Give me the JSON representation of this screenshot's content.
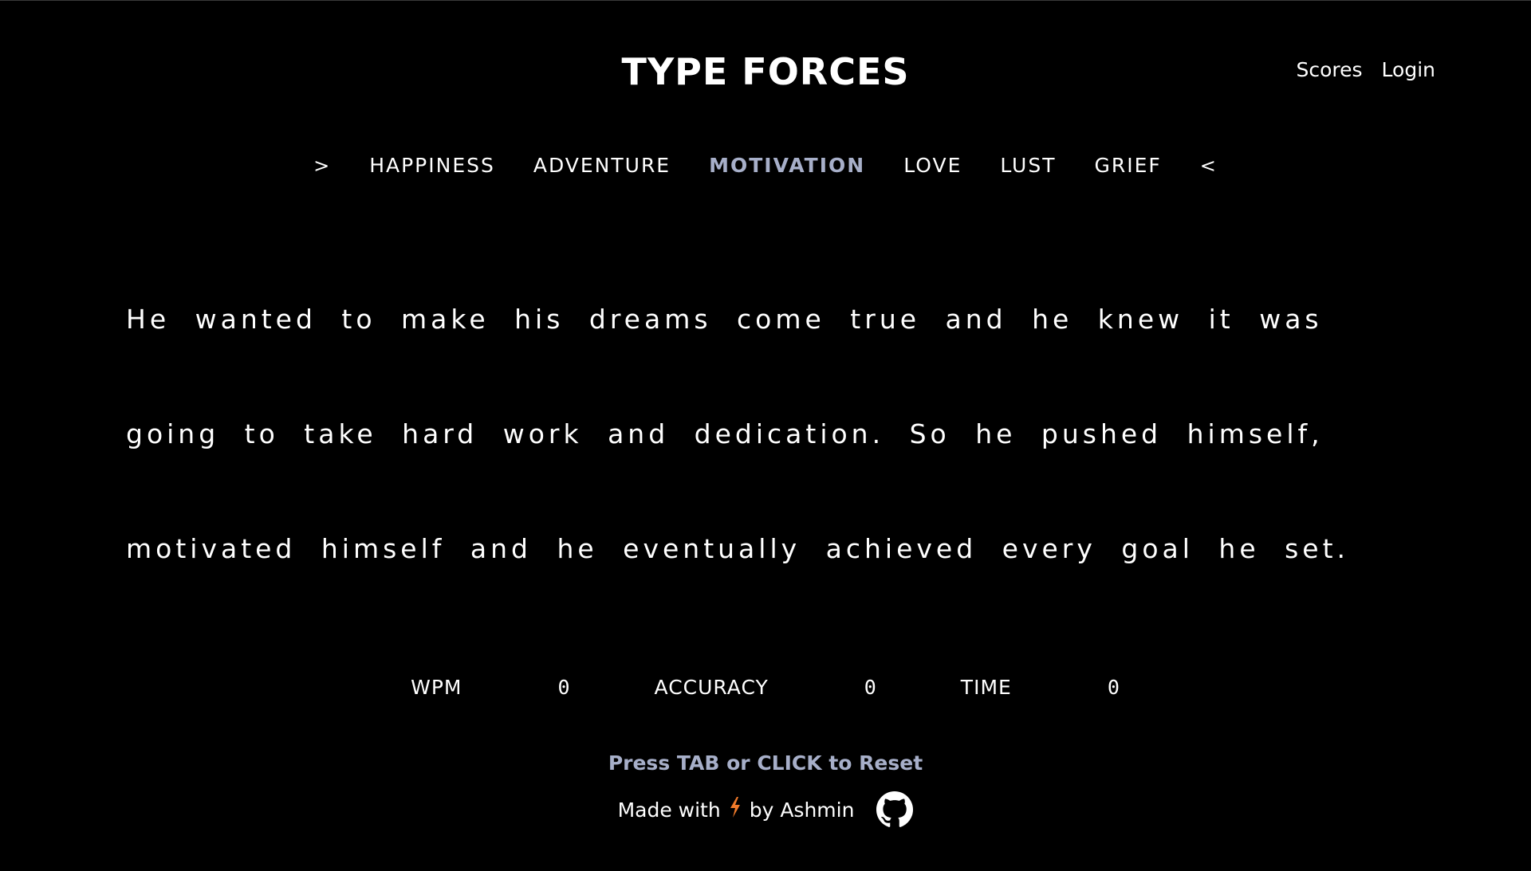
{
  "header": {
    "title": "TYPE FORCES",
    "nav": {
      "scores": "Scores",
      "login": "Login"
    }
  },
  "categories": {
    "left_arrow": ">",
    "right_arrow": "<",
    "items": [
      "HAPPINESS",
      "ADVENTURE",
      "MOTIVATION",
      "LOVE",
      "LUST",
      "GRIEF"
    ],
    "active": "MOTIVATION"
  },
  "passage": {
    "lines": [
      "He wanted to make his dreams come true and he knew it was",
      "going to take hard work and dedication. So he pushed himself,",
      "motivated himself and he eventually achieved every goal he set."
    ]
  },
  "stats": {
    "wpm_label": "WPM",
    "wpm_value": "0",
    "accuracy_label": "ACCURACY",
    "accuracy_value": "0",
    "time_label": "TIME",
    "time_value": "0"
  },
  "reset_hint": "Press TAB or CLICK to Reset",
  "footer": {
    "made_with": "Made with",
    "bolt_icon": "lightning-bolt-icon",
    "by": "by Ashmin",
    "github_icon": "github-icon"
  },
  "colors": {
    "background": "#000000",
    "text": "#ffffff",
    "accent": "#a7afc9",
    "bolt": "#f07a2a"
  }
}
